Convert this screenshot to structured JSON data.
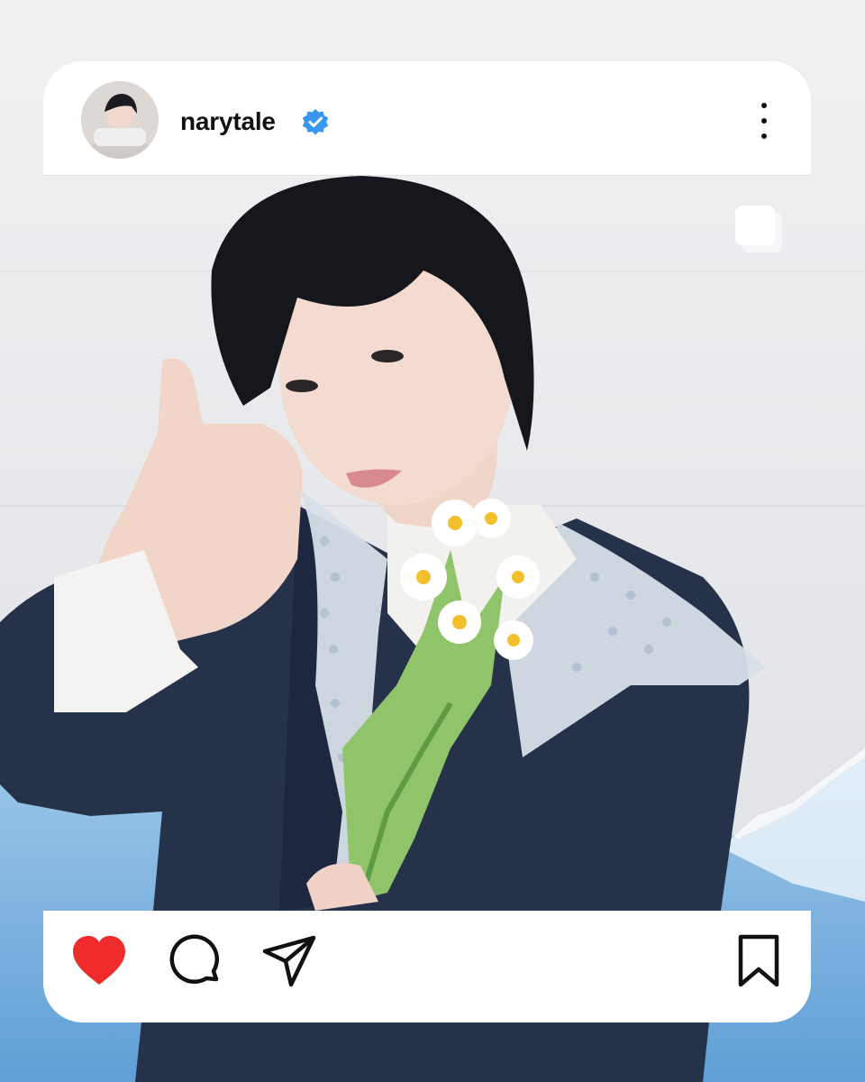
{
  "post": {
    "username": "narytale",
    "verified": true
  },
  "colors": {
    "like_red": "#ef2b2b",
    "verified_blue": "#3897f0",
    "sky_blue": "#78b0dc",
    "jacket_navy": "#26324a"
  },
  "icons": {
    "more": "more-vertical-icon",
    "like": "heart-icon",
    "comment": "comment-bubble-icon",
    "share": "paper-plane-icon",
    "save": "bookmark-icon",
    "carousel": "multiple-photos-icon"
  }
}
